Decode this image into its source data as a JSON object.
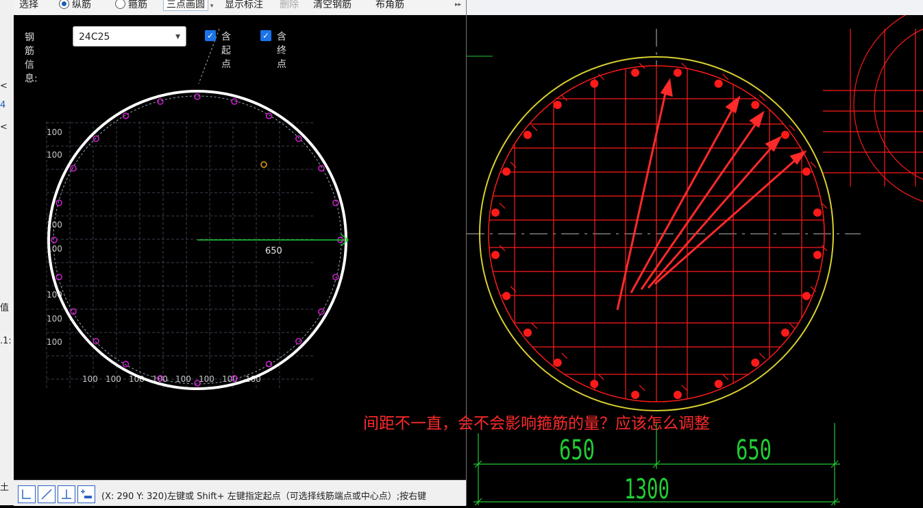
{
  "toolbar": {
    "select": "选择",
    "longitudinal": "纵筋",
    "stirrup": "箍筋",
    "draw_mode": "三点画圆",
    "show_label": "显示标注",
    "delete": "删除",
    "clear": "清空钢筋",
    "corner": "布角筋",
    "more": "▸▸"
  },
  "sidebar": {
    "items": [
      "<",
      "4",
      "<",
      "值",
      ".1:",
      "土"
    ]
  },
  "rebar": {
    "label": "钢筋信息:",
    "value": "24C25",
    "has_start": "含起点",
    "has_end": "含终点"
  },
  "left_drawing": {
    "radius_label": "650",
    "grid_labels": [
      "100",
      "100",
      "100",
      "100",
      "100",
      "100",
      "100",
      "100",
      "100",
      "100",
      "100",
      "100",
      "100",
      "100",
      "100"
    ]
  },
  "status": {
    "text": "(X: 290 Y: 320)左键或 Shift+ 左键指定起点（可选择线筋端点或中心点）;按右键"
  },
  "right_drawing": {
    "annotation": "间距不一直，会不会影响箍筋的量？应该怎么调整",
    "dim_left": "650",
    "dim_right": "650",
    "dim_total": "1300"
  },
  "colors": {
    "white": "#ffffff",
    "magenta": "#d020d0",
    "grid": "#3c4050",
    "green": "#22cc33",
    "red": "#ff1a1a",
    "yellow": "#d8d030"
  }
}
